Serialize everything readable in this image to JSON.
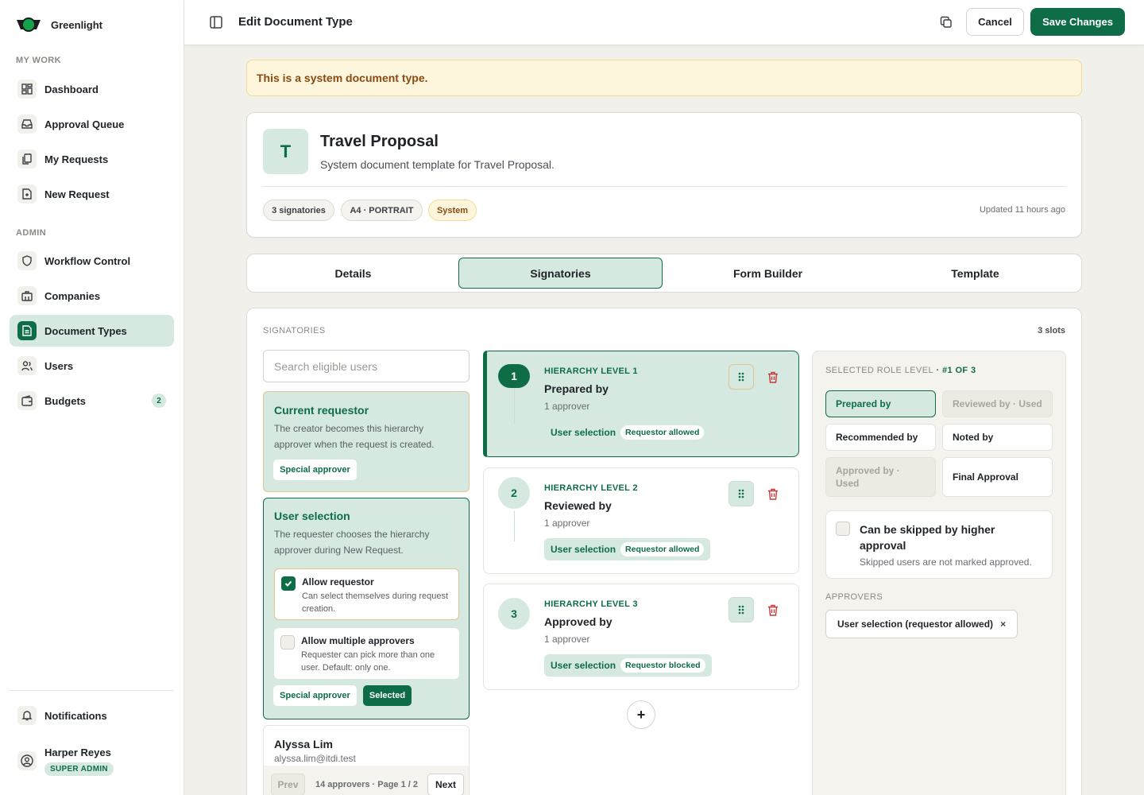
{
  "app": {
    "name": "Greenlight"
  },
  "sidebar": {
    "my_work_label": "MY WORK",
    "admin_label": "ADMIN",
    "my_work": [
      {
        "label": "Dashboard",
        "icon": "dashboard-icon"
      },
      {
        "label": "Approval Queue",
        "icon": "inbox-icon"
      },
      {
        "label": "My Requests",
        "icon": "documents-icon"
      },
      {
        "label": "New Request",
        "icon": "file-plus-icon"
      }
    ],
    "admin": [
      {
        "label": "Workflow Control",
        "icon": "shield-icon"
      },
      {
        "label": "Companies",
        "icon": "building-icon"
      },
      {
        "label": "Document Types",
        "icon": "file-text-icon",
        "active": true
      },
      {
        "label": "Users",
        "icon": "users-icon"
      },
      {
        "label": "Budgets",
        "icon": "wallet-icon",
        "badge": "2"
      }
    ],
    "notifications": "Notifications",
    "user": {
      "name": "Harper Reyes",
      "role": "SUPER ADMIN"
    }
  },
  "topbar": {
    "title": "Edit Document Type",
    "cancel": "Cancel",
    "save": "Save Changes"
  },
  "notice": "This is a system document type.",
  "document": {
    "initial": "T",
    "title": "Travel Proposal",
    "subtitle": "System document template for Travel Proposal.",
    "chips": [
      "3 signatories",
      "A4 · PORTRAIT",
      "System"
    ],
    "updated": "Updated 11 hours ago"
  },
  "tabs": [
    "Details",
    "Signatories",
    "Form Builder",
    "Template"
  ],
  "signatories": {
    "label": "SIGNATORIES",
    "slots": "3 slots",
    "search_placeholder": "Search eligible users",
    "current_requestor": {
      "title": "Current requestor",
      "desc": "The creator becomes this hierarchy approver when the request is created.",
      "button": "Special approver"
    },
    "user_selection": {
      "title": "User selection",
      "desc": "The requester chooses the hierarchy approver during New Request.",
      "allow_requestor": {
        "title": "Allow requestor",
        "desc": "Can select themselves during request creation.",
        "checked": true
      },
      "allow_multiple": {
        "title": "Allow multiple approvers",
        "desc": "Requester can pick more than one user. Default: only one.",
        "checked": false
      },
      "special_button": "Special approver",
      "selected_button": "Selected"
    },
    "person": {
      "name": "Alyssa Lim",
      "email": "alyssa.lim@itdi.test"
    },
    "pager": {
      "prev": "Prev",
      "text": "14 approvers · Page 1 / 2",
      "next": "Next"
    },
    "levels": [
      {
        "num": "1",
        "caption": "HIERARCHY LEVEL 1",
        "name": "Prepared by",
        "count": "1 approver",
        "tag": "User selection",
        "tag_sub": "Requestor allowed"
      },
      {
        "num": "2",
        "caption": "HIERARCHY LEVEL 2",
        "name": "Reviewed by",
        "count": "1 approver",
        "tag": "User selection",
        "tag_sub": "Requestor allowed"
      },
      {
        "num": "3",
        "caption": "HIERARCHY LEVEL 3",
        "name": "Approved by",
        "count": "1 approver",
        "tag": "User selection",
        "tag_sub": "Requestor blocked"
      }
    ],
    "add_label": "+",
    "selected_role": {
      "heading": "SELECTED ROLE LEVEL",
      "heading_sep": " · ",
      "position": "#1 OF 3",
      "roles": [
        {
          "label": "Prepared by",
          "state": "selected"
        },
        {
          "label": "Reviewed by · Used",
          "state": "used"
        },
        {
          "label": "Recommended by",
          "state": "normal"
        },
        {
          "label": "Noted by",
          "state": "normal"
        },
        {
          "label": "Approved by · Used",
          "state": "used"
        },
        {
          "label": "Final Approval",
          "state": "normal"
        }
      ],
      "skip": {
        "title": "Can be skipped by higher approval",
        "desc": "Skipped users are not marked approved.",
        "checked": false
      },
      "approvers_label": "APPROVERS",
      "approver_chip": "User selection (requestor allowed)",
      "remove_glyph": "×"
    }
  },
  "colors": {
    "brand": "#0e6d47",
    "accent_bg": "#d5e9e0",
    "warning_bg": "#fdf6dc",
    "danger": "#c23b3b"
  }
}
